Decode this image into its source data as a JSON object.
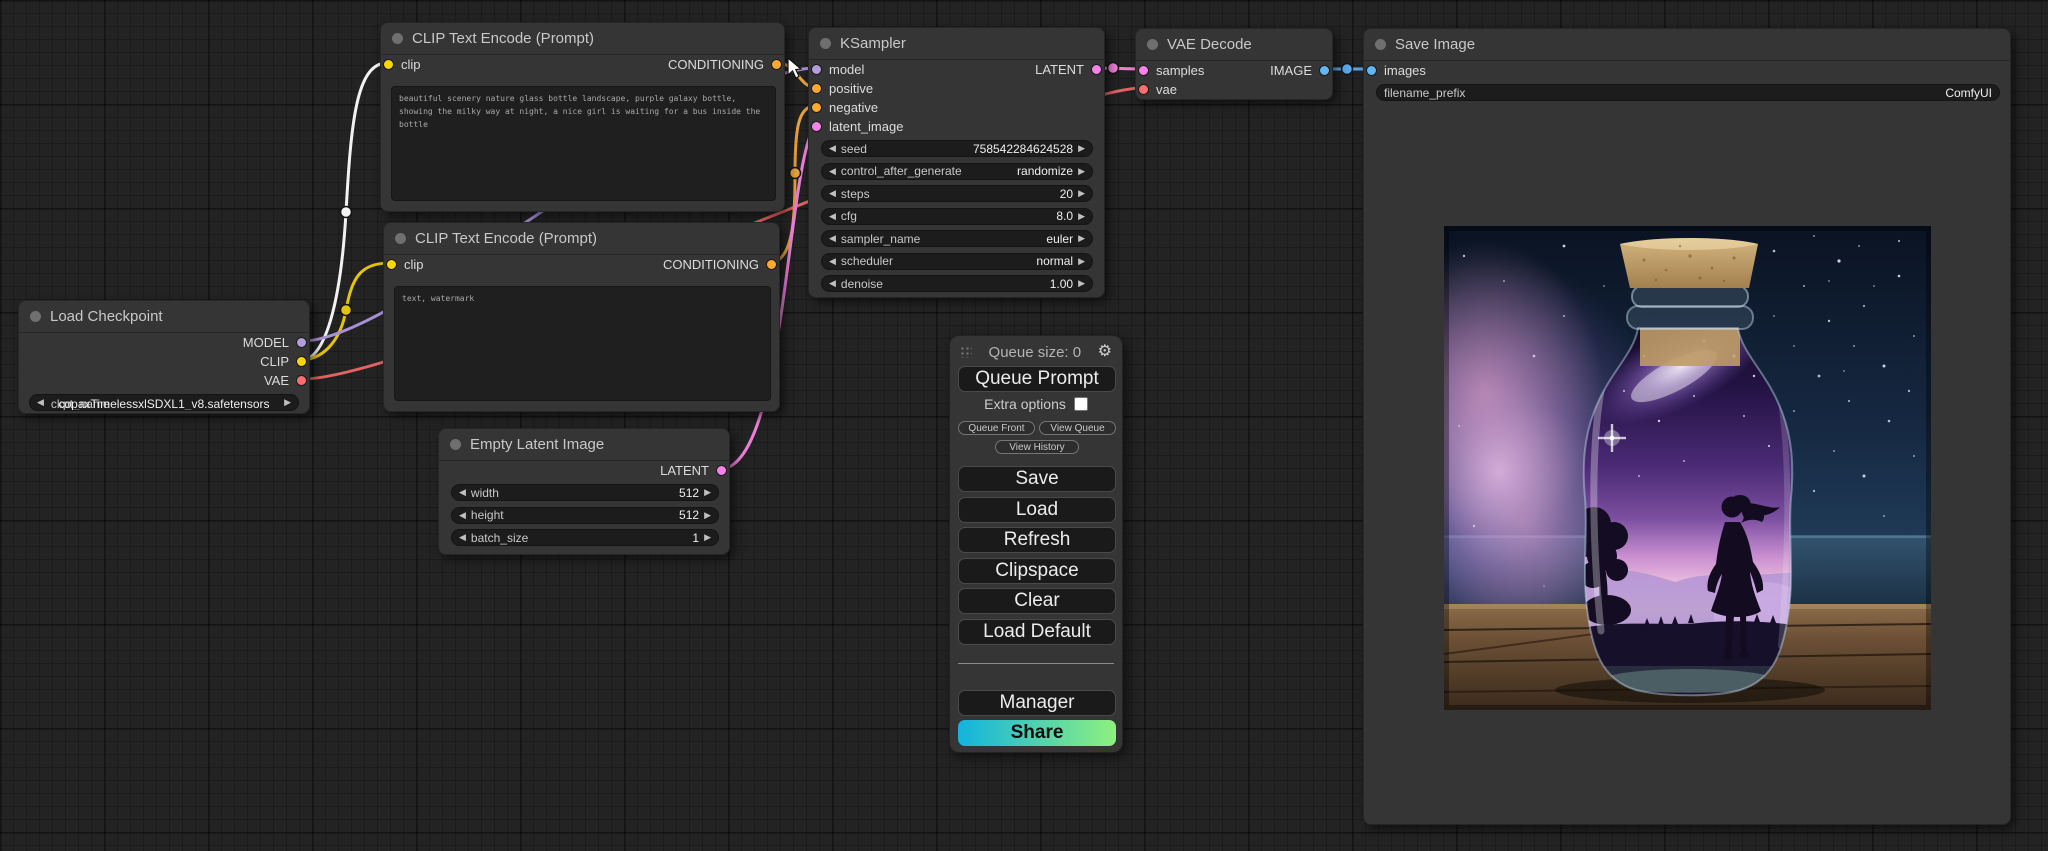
{
  "nodes": [
    {
      "title": "Load Checkpoint",
      "outputs": [
        "MODEL",
        "CLIP",
        "VAE"
      ],
      "widgets": [
        {
          "label": "ckpt_name",
          "value": "copaxTimelessxlSDXL1_v8.safetensors"
        }
      ]
    },
    {
      "title": "CLIP Text Encode (Prompt)",
      "inputs": [
        "clip"
      ],
      "outputs": [
        "CONDITIONING"
      ],
      "text": "beautiful scenery nature glass bottle landscape, purple galaxy bottle, showing the milky way at night, a nice girl is waiting for a bus inside the bottle"
    },
    {
      "title": "CLIP Text Encode (Prompt)",
      "inputs": [
        "clip"
      ],
      "outputs": [
        "CONDITIONING"
      ],
      "text": "text, watermark"
    },
    {
      "title": "Empty Latent Image",
      "outputs": [
        "LATENT"
      ],
      "widgets": [
        {
          "label": "width",
          "value": "512"
        },
        {
          "label": "height",
          "value": "512"
        },
        {
          "label": "batch_size",
          "value": "1"
        }
      ]
    },
    {
      "title": "KSampler",
      "inputs": [
        "model",
        "positive",
        "negative",
        "latent_image"
      ],
      "outputs": [
        "LATENT"
      ],
      "widgets": [
        {
          "label": "seed",
          "value": "758542284624528"
        },
        {
          "label": "control_after_generate",
          "value": "randomize"
        },
        {
          "label": "steps",
          "value": "20"
        },
        {
          "label": "cfg",
          "value": "8.0"
        },
        {
          "label": "sampler_name",
          "value": "euler"
        },
        {
          "label": "scheduler",
          "value": "normal"
        },
        {
          "label": "denoise",
          "value": "1.00"
        }
      ]
    },
    {
      "title": "VAE Decode",
      "inputs": [
        "samples",
        "vae"
      ],
      "outputs": [
        "IMAGE"
      ]
    },
    {
      "title": "Save Image",
      "inputs": [
        "images"
      ],
      "widgets": [
        {
          "label": "filename_prefix",
          "value": "ComfyUI"
        }
      ]
    }
  ],
  "menu": {
    "queue_size": "Queue size: 0",
    "queue_prompt": "Queue Prompt",
    "extra_options": "Extra options",
    "queue_front": "Queue Front",
    "view_queue": "View Queue",
    "view_history": "View History",
    "save": "Save",
    "load": "Load",
    "refresh": "Refresh",
    "clipspace": "Clipspace",
    "clear": "Clear",
    "load_default": "Load Default",
    "manager": "Manager",
    "share": "Share"
  },
  "colors": {
    "model": "#B39DDB",
    "clip": "#FFD500",
    "conditioning": "#FFA931",
    "latent": "#F783E8",
    "vae": "#FF6E6E",
    "image": "#64B5F6",
    "share_gradient_start": "#12b3e0",
    "share_gradient_end": "#8ef07e"
  }
}
